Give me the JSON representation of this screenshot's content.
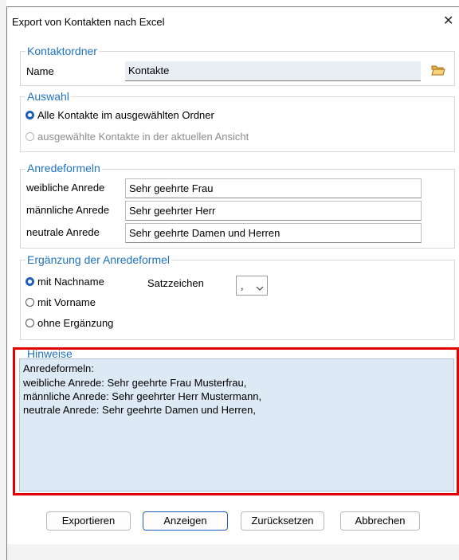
{
  "window": {
    "title": "Export von Kontakten nach Excel",
    "close_glyph": "✕"
  },
  "kontaktordner": {
    "legend": "Kontaktordner",
    "name_label": "Name",
    "name_value": "Kontakte",
    "folder_icon": "folder-open-icon"
  },
  "auswahl": {
    "legend": "Auswahl",
    "options": [
      {
        "label": "Alle Kontakte im ausgewählten Ordner",
        "checked": true,
        "enabled": true
      },
      {
        "label": "ausgewählte Kontakte in der aktuellen Ansicht",
        "checked": false,
        "enabled": false
      }
    ]
  },
  "anredeformeln": {
    "legend": "Anredeformeln",
    "rows": [
      {
        "label": "weibliche Anrede",
        "value": "Sehr geehrte Frau"
      },
      {
        "label": "männliche Anrede",
        "value": "Sehr geehrter Herr"
      },
      {
        "label": "neutrale Anrede",
        "value": "Sehr geehrte Damen und Herren"
      }
    ]
  },
  "ergaenzung": {
    "legend": "Ergänzung der Anredeformel",
    "options": [
      {
        "label": "mit Nachname",
        "checked": true
      },
      {
        "label": "mit Vorname",
        "checked": false
      },
      {
        "label": "ohne Ergänzung",
        "checked": false
      }
    ],
    "satzzeichen_label": "Satzzeichen",
    "satzzeichen_value": ","
  },
  "hinweise": {
    "legend": "Hinweise",
    "lines": [
      "Anredeformeln:",
      "weibliche Anrede: Sehr geehrte Frau Musterfrau,",
      "männliche Anrede: Sehr geehrter Herr Mustermann,",
      "neutrale Anrede: Sehr geehrte Damen und Herren,"
    ]
  },
  "buttons": {
    "export": "Exportieren",
    "show": "Anzeigen",
    "reset": "Zurücksetzen",
    "cancel": "Abbrechen"
  },
  "colors": {
    "accent": "#1f73c2",
    "highlight": "#e10000",
    "hint_bg": "#dde9f5"
  }
}
